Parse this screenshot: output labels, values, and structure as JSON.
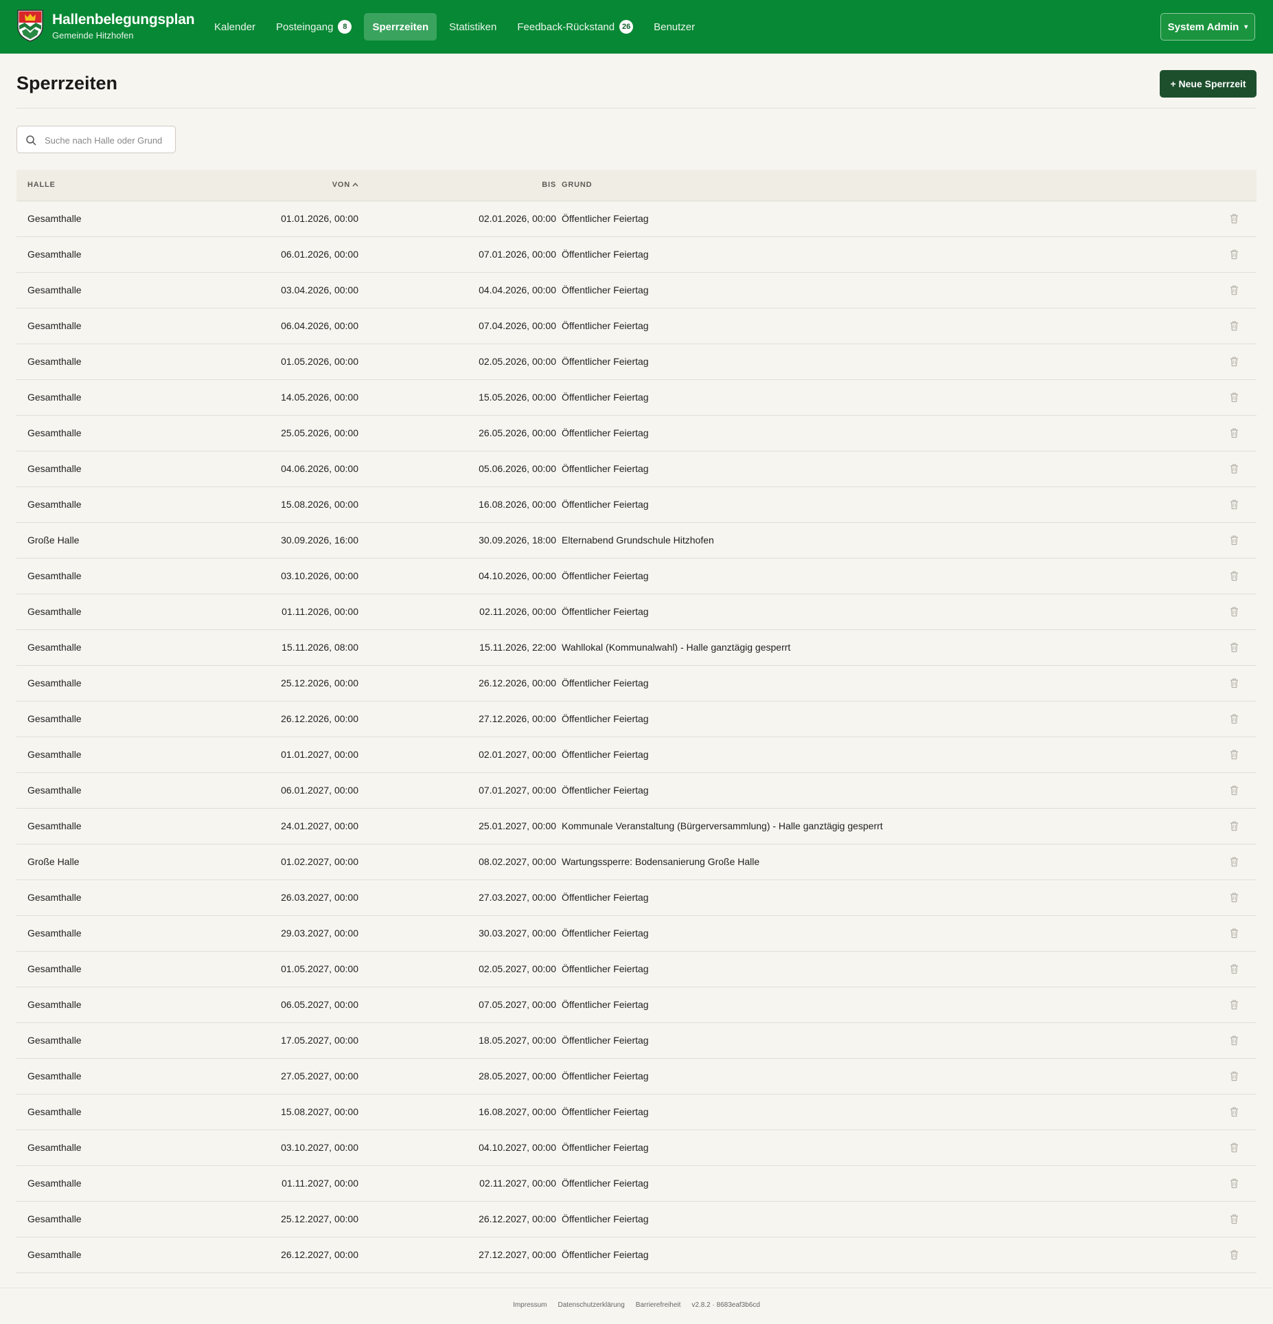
{
  "app": {
    "title": "Hallenbelegungsplan",
    "subtitle": "Gemeinde Hitzhofen",
    "logo_icon": "coat-of-arms-icon"
  },
  "nav": {
    "items": [
      {
        "label": "Kalender",
        "badge": ""
      },
      {
        "label": "Posteingang",
        "badge": "8"
      },
      {
        "label": "Sperrzeiten",
        "badge": "",
        "active": true
      },
      {
        "label": "Statistiken",
        "badge": ""
      },
      {
        "label": "Feedback-Rückstand",
        "badge": "26"
      },
      {
        "label": "Benutzer",
        "badge": ""
      }
    ]
  },
  "user_menu": {
    "label": "System Admin",
    "caret": "▾"
  },
  "page": {
    "title": "Sperrzeiten",
    "new_button": "+ Neue Sperrzeit"
  },
  "search": {
    "placeholder": "Suche nach Halle oder Grund",
    "value": "",
    "icon": "search-icon"
  },
  "table": {
    "headers": {
      "halle": "HALLE",
      "von": "VON",
      "bis": "BIS",
      "grund": "GRUND"
    },
    "sort": {
      "column": "von",
      "direction": "asc"
    },
    "rows": [
      {
        "halle": "Gesamthalle",
        "von": "01.01.2026, 00:00",
        "bis": "02.01.2026, 00:00",
        "grund": "Öffentlicher Feiertag"
      },
      {
        "halle": "Gesamthalle",
        "von": "06.01.2026, 00:00",
        "bis": "07.01.2026, 00:00",
        "grund": "Öffentlicher Feiertag"
      },
      {
        "halle": "Gesamthalle",
        "von": "03.04.2026, 00:00",
        "bis": "04.04.2026, 00:00",
        "grund": "Öffentlicher Feiertag"
      },
      {
        "halle": "Gesamthalle",
        "von": "06.04.2026, 00:00",
        "bis": "07.04.2026, 00:00",
        "grund": "Öffentlicher Feiertag"
      },
      {
        "halle": "Gesamthalle",
        "von": "01.05.2026, 00:00",
        "bis": "02.05.2026, 00:00",
        "grund": "Öffentlicher Feiertag"
      },
      {
        "halle": "Gesamthalle",
        "von": "14.05.2026, 00:00",
        "bis": "15.05.2026, 00:00",
        "grund": "Öffentlicher Feiertag"
      },
      {
        "halle": "Gesamthalle",
        "von": "25.05.2026, 00:00",
        "bis": "26.05.2026, 00:00",
        "grund": "Öffentlicher Feiertag"
      },
      {
        "halle": "Gesamthalle",
        "von": "04.06.2026, 00:00",
        "bis": "05.06.2026, 00:00",
        "grund": "Öffentlicher Feiertag"
      },
      {
        "halle": "Gesamthalle",
        "von": "15.08.2026, 00:00",
        "bis": "16.08.2026, 00:00",
        "grund": "Öffentlicher Feiertag"
      },
      {
        "halle": "Große Halle",
        "von": "30.09.2026, 16:00",
        "bis": "30.09.2026, 18:00",
        "grund": "Elternabend Grundschule Hitzhofen"
      },
      {
        "halle": "Gesamthalle",
        "von": "03.10.2026, 00:00",
        "bis": "04.10.2026, 00:00",
        "grund": "Öffentlicher Feiertag"
      },
      {
        "halle": "Gesamthalle",
        "von": "01.11.2026, 00:00",
        "bis": "02.11.2026, 00:00",
        "grund": "Öffentlicher Feiertag"
      },
      {
        "halle": "Gesamthalle",
        "von": "15.11.2026, 08:00",
        "bis": "15.11.2026, 22:00",
        "grund": "Wahllokal (Kommunalwahl) - Halle ganztägig gesperrt"
      },
      {
        "halle": "Gesamthalle",
        "von": "25.12.2026, 00:00",
        "bis": "26.12.2026, 00:00",
        "grund": "Öffentlicher Feiertag"
      },
      {
        "halle": "Gesamthalle",
        "von": "26.12.2026, 00:00",
        "bis": "27.12.2026, 00:00",
        "grund": "Öffentlicher Feiertag"
      },
      {
        "halle": "Gesamthalle",
        "von": "01.01.2027, 00:00",
        "bis": "02.01.2027, 00:00",
        "grund": "Öffentlicher Feiertag"
      },
      {
        "halle": "Gesamthalle",
        "von": "06.01.2027, 00:00",
        "bis": "07.01.2027, 00:00",
        "grund": "Öffentlicher Feiertag"
      },
      {
        "halle": "Gesamthalle",
        "von": "24.01.2027, 00:00",
        "bis": "25.01.2027, 00:00",
        "grund": "Kommunale Veranstaltung (Bürgerversammlung) - Halle ganztägig gesperrt"
      },
      {
        "halle": "Große Halle",
        "von": "01.02.2027, 00:00",
        "bis": "08.02.2027, 00:00",
        "grund": "Wartungssperre: Bodensanierung Große Halle"
      },
      {
        "halle": "Gesamthalle",
        "von": "26.03.2027, 00:00",
        "bis": "27.03.2027, 00:00",
        "grund": "Öffentlicher Feiertag"
      },
      {
        "halle": "Gesamthalle",
        "von": "29.03.2027, 00:00",
        "bis": "30.03.2027, 00:00",
        "grund": "Öffentlicher Feiertag"
      },
      {
        "halle": "Gesamthalle",
        "von": "01.05.2027, 00:00",
        "bis": "02.05.2027, 00:00",
        "grund": "Öffentlicher Feiertag"
      },
      {
        "halle": "Gesamthalle",
        "von": "06.05.2027, 00:00",
        "bis": "07.05.2027, 00:00",
        "grund": "Öffentlicher Feiertag"
      },
      {
        "halle": "Gesamthalle",
        "von": "17.05.2027, 00:00",
        "bis": "18.05.2027, 00:00",
        "grund": "Öffentlicher Feiertag"
      },
      {
        "halle": "Gesamthalle",
        "von": "27.05.2027, 00:00",
        "bis": "28.05.2027, 00:00",
        "grund": "Öffentlicher Feiertag"
      },
      {
        "halle": "Gesamthalle",
        "von": "15.08.2027, 00:00",
        "bis": "16.08.2027, 00:00",
        "grund": "Öffentlicher Feiertag"
      },
      {
        "halle": "Gesamthalle",
        "von": "03.10.2027, 00:00",
        "bis": "04.10.2027, 00:00",
        "grund": "Öffentlicher Feiertag"
      },
      {
        "halle": "Gesamthalle",
        "von": "01.11.2027, 00:00",
        "bis": "02.11.2027, 00:00",
        "grund": "Öffentlicher Feiertag"
      },
      {
        "halle": "Gesamthalle",
        "von": "25.12.2027, 00:00",
        "bis": "26.12.2027, 00:00",
        "grund": "Öffentlicher Feiertag"
      },
      {
        "halle": "Gesamthalle",
        "von": "26.12.2027, 00:00",
        "bis": "27.12.2027, 00:00",
        "grund": "Öffentlicher Feiertag"
      }
    ],
    "row_action_icon": "trash-icon"
  },
  "footer": {
    "links": [
      "Impressum",
      "Datenschutzerklärung",
      "Barrierefreiheit"
    ],
    "version": "v2.8.2 · 8683eaf3b6cd"
  },
  "colors": {
    "header_green": "#078834",
    "nav_active": "#3aa35e",
    "primary_button": "#1d4f2d",
    "background": "#f7f5f0"
  }
}
